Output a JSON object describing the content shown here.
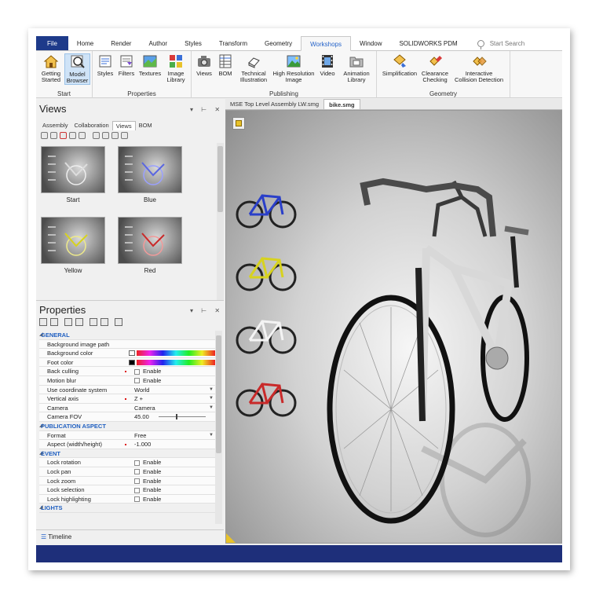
{
  "ribbon_tabs": [
    "File",
    "Home",
    "Render",
    "Author",
    "Styles",
    "Transform",
    "Geometry",
    "Workshops",
    "Window",
    "SOLIDWORKS PDM"
  ],
  "active_tab": "Workshops",
  "search_placeholder": "Start Search",
  "groups": {
    "start": {
      "label": "Start",
      "getting_started": [
        "Getting",
        "Started"
      ],
      "model_browser": [
        "Model",
        "Browser"
      ]
    },
    "properties": {
      "label": "Properties",
      "styles": "Styles",
      "filters": "Filters",
      "textures": "Textures",
      "image_library": [
        "Image",
        "Library"
      ]
    },
    "publishing": {
      "label": "Publishing",
      "views": "Views",
      "bom": "BOM",
      "technical_illustration": [
        "Technical",
        "Illustration"
      ],
      "high_resolution_image": [
        "High Resolution",
        "Image"
      ],
      "video": "Video",
      "animation_library": [
        "Animation",
        "Library"
      ]
    },
    "geometry": {
      "label": "Geometry",
      "simplification": "Simplification",
      "clearance_checking": [
        "Clearance",
        "Checking"
      ],
      "interactive_collision": [
        "Interactive",
        "Collision Detection"
      ]
    }
  },
  "views_panel": {
    "title": "Views",
    "controls": "▾ ⊢ ✕",
    "tabs": [
      "Assembly",
      "Collaboration",
      "Views",
      "BOM"
    ],
    "active_tab": "Views",
    "thumbnails": [
      "Start",
      "Blue",
      "Yellow",
      "Red"
    ]
  },
  "properties_panel": {
    "title": "Properties",
    "controls": "▾ ⊢ ✕",
    "sections": {
      "general": "GENERAL",
      "publication": "PUBLICATION ASPECT",
      "event": "EVENT",
      "lights": "LIGHTS"
    },
    "rows": {
      "bg_image_path": "Background image path",
      "bg_color": "Background color",
      "foot_color": "Foot color",
      "back_culling": {
        "name": "Back culling",
        "value": "Enable"
      },
      "motion_blur": {
        "name": "Motion blur",
        "value": "Enable"
      },
      "coord_system": {
        "name": "Use coordinate system",
        "value": "World"
      },
      "vertical_axis": {
        "name": "Vertical axis",
        "value": "Z +"
      },
      "camera": {
        "name": "Camera",
        "value": "Camera"
      },
      "camera_fov": {
        "name": "Camera FOV",
        "value": "45.00"
      },
      "format": {
        "name": "Format",
        "value": "Free"
      },
      "aspect": {
        "name": "Aspect (width/height)",
        "value": "-1.000"
      },
      "lock_rotation": {
        "name": "Lock rotation",
        "value": "Enable"
      },
      "lock_pan": {
        "name": "Lock pan",
        "value": "Enable"
      },
      "lock_zoom": {
        "name": "Lock zoom",
        "value": "Enable"
      },
      "lock_selection": {
        "name": "Lock selection",
        "value": "Enable"
      },
      "lock_highlighting": {
        "name": "Lock highlighting",
        "value": "Enable"
      }
    }
  },
  "timeline_label": "Timeline",
  "doc_tabs": [
    "MSE Top Level Assembly LW.smg",
    "bike.smg"
  ],
  "active_doc": "bike.smg",
  "colors": {
    "file_tab": "#1e3a8a",
    "accent": "#2563c9",
    "status_bar": "#1e2f7a",
    "bike_blue": "#2a3fc9",
    "bike_yellow": "#d7d21f",
    "bike_white": "#e8e8e8",
    "bike_red": "#c92a2a"
  }
}
